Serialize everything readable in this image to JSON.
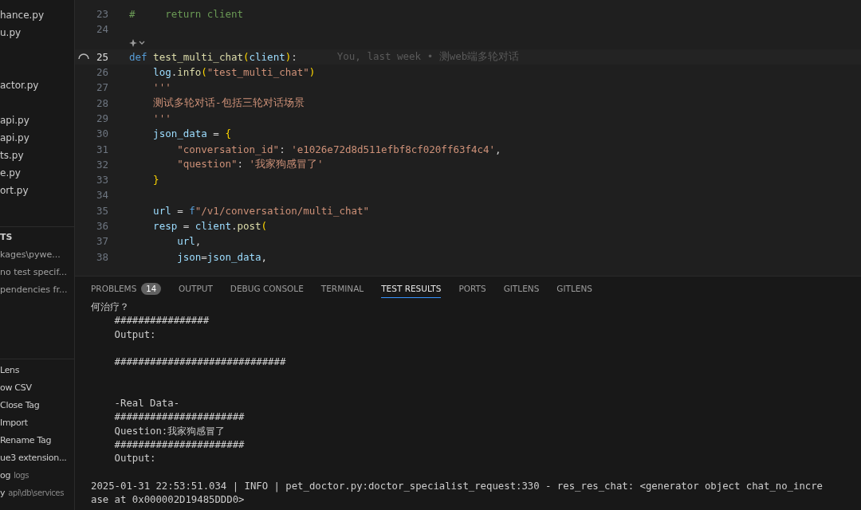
{
  "sidebar": {
    "files": [
      {
        "label": "hance.py"
      },
      {
        "label": "u.py"
      },
      {
        "kind": "gap"
      },
      {
        "kind": "gap"
      },
      {
        "label": "actor.py"
      },
      {
        "kind": "gap"
      },
      {
        "label": "api.py"
      },
      {
        "label": "api.py"
      },
      {
        "label": "ts.py"
      },
      {
        "label": "e.py"
      },
      {
        "label": "ort.py"
      }
    ],
    "section": {
      "title": "TS",
      "items": [
        {
          "label": "kages\\pywe..."
        },
        {
          "label": "no test specif..."
        },
        {
          "label": "pendencies fr..."
        }
      ]
    },
    "extensions": [
      {
        "label": "Lens"
      },
      {
        "label": "ow CSV"
      },
      {
        "label": "Close Tag"
      },
      {
        "label": "Import"
      },
      {
        "label": "Rename Tag"
      },
      {
        "label": "ue3 extension..."
      },
      {
        "label": "og",
        "description": "logs"
      },
      {
        "label": "y",
        "description": "api\\db\\services"
      }
    ]
  },
  "editor": {
    "lines": [
      {
        "number": "23",
        "current": false,
        "tokens": [
          {
            "kind": "comment",
            "text": "#     return client"
          }
        ]
      },
      {
        "number": "24",
        "current": false
      },
      {
        "kind": "codelens"
      },
      {
        "number": "25",
        "current": true,
        "tokens": [
          {
            "kind": "keyword",
            "text": "def "
          },
          {
            "kind": "function",
            "text": "test_multi_chat"
          },
          {
            "kind": "brace",
            "text": "("
          },
          {
            "kind": "variable",
            "text": "client"
          },
          {
            "kind": "brace",
            "text": ")"
          },
          {
            "kind": "plain",
            "text": ":"
          }
        ],
        "blame": "You, last week • 测web端多轮对话"
      },
      {
        "number": "26",
        "current": false,
        "tokens": [
          {
            "kind": "variable",
            "text": "    log"
          },
          {
            "kind": "plain",
            "text": "."
          },
          {
            "kind": "function",
            "text": "info"
          },
          {
            "kind": "brace",
            "text": "("
          },
          {
            "kind": "string",
            "text": "\"test_multi_chat\""
          },
          {
            "kind": "brace",
            "text": ")"
          }
        ]
      },
      {
        "number": "27",
        "current": false,
        "tokens": [
          {
            "kind": "string",
            "text": "    '''"
          }
        ]
      },
      {
        "number": "28",
        "current": false,
        "tokens": [
          {
            "kind": "string",
            "text": "    测试多轮对话-包括三轮对话场景"
          }
        ]
      },
      {
        "number": "29",
        "current": false,
        "tokens": [
          {
            "kind": "string",
            "text": "    '''"
          }
        ]
      },
      {
        "number": "30",
        "current": false,
        "tokens": [
          {
            "kind": "variable",
            "text": "    json_data"
          },
          {
            "kind": "plain",
            "text": " = "
          },
          {
            "kind": "brace",
            "text": "{"
          }
        ]
      },
      {
        "number": "31",
        "current": false,
        "tokens": [
          {
            "kind": "string",
            "text": "        \"conversation_id\""
          },
          {
            "kind": "plain",
            "text": ": "
          },
          {
            "kind": "string",
            "text": "'e1026e72d8d511efbf8cf020ff63f4c4'"
          },
          {
            "kind": "plain",
            "text": ","
          }
        ]
      },
      {
        "number": "32",
        "current": false,
        "tokens": [
          {
            "kind": "string",
            "text": "        \"question\""
          },
          {
            "kind": "plain",
            "text": ": "
          },
          {
            "kind": "string",
            "text": "'我家狗感冒了'"
          }
        ]
      },
      {
        "number": "33",
        "current": false,
        "tokens": [
          {
            "kind": "brace",
            "text": "    }"
          }
        ]
      },
      {
        "number": "34",
        "current": false
      },
      {
        "number": "35",
        "current": false,
        "tokens": [
          {
            "kind": "variable",
            "text": "    url"
          },
          {
            "kind": "plain",
            "text": " = "
          },
          {
            "kind": "keyword",
            "text": "f"
          },
          {
            "kind": "string",
            "text": "\"/v1/conversation/multi_chat\""
          }
        ]
      },
      {
        "number": "36",
        "current": false,
        "tokens": [
          {
            "kind": "variable",
            "text": "    resp"
          },
          {
            "kind": "plain",
            "text": " = "
          },
          {
            "kind": "variable",
            "text": "client"
          },
          {
            "kind": "plain",
            "text": "."
          },
          {
            "kind": "function",
            "text": "post"
          },
          {
            "kind": "brace",
            "text": "("
          }
        ]
      },
      {
        "number": "37",
        "current": false,
        "tokens": [
          {
            "kind": "variable",
            "text": "        url"
          },
          {
            "kind": "plain",
            "text": ","
          }
        ]
      },
      {
        "number": "38",
        "current": false,
        "tokens": [
          {
            "kind": "variable",
            "text": "        json"
          },
          {
            "kind": "plain",
            "text": "="
          },
          {
            "kind": "variable",
            "text": "json_data"
          },
          {
            "kind": "plain",
            "text": ","
          }
        ]
      }
    ]
  },
  "panel": {
    "tabs": [
      {
        "label": "PROBLEMS",
        "badge": "14",
        "selected": false
      },
      {
        "label": "OUTPUT",
        "selected": false
      },
      {
        "label": "DEBUG CONSOLE",
        "selected": false
      },
      {
        "label": "TERMINAL",
        "selected": false
      },
      {
        "label": "TEST RESULTS",
        "selected": true
      },
      {
        "label": "PORTS",
        "selected": false
      },
      {
        "label": "GITLENS",
        "selected": false
      },
      {
        "label": "GITLENS",
        "selected": false
      }
    ],
    "output": [
      {
        "text": "何治疗？"
      },
      {
        "text": "    ################"
      },
      {
        "text": "    Output:"
      },
      {
        "kind": "blank"
      },
      {
        "text": "    #############################"
      },
      {
        "kind": "blank"
      },
      {
        "kind": "blank"
      },
      {
        "text": "    -Real Data-"
      },
      {
        "text": "    ######################"
      },
      {
        "text": "    Question:我家狗感冒了"
      },
      {
        "text": "    ######################"
      },
      {
        "text": "    Output:"
      },
      {
        "kind": "blank"
      },
      {
        "text": "2025-01-31 22:53:51.034 | INFO | pet_doctor.py:doctor_specialist_request:330 - res_res_chat: <generator object chat_no_incre"
      },
      {
        "text": "ase at 0x000002D19485DDD0>"
      }
    ]
  }
}
